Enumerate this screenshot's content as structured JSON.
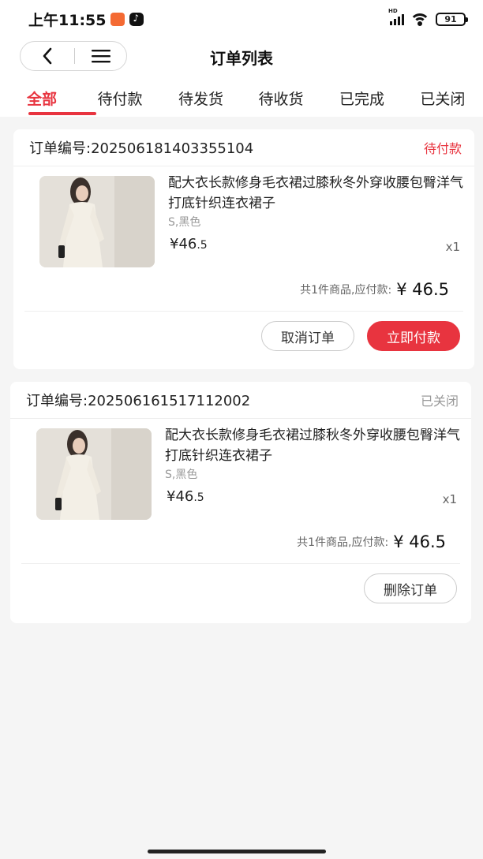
{
  "status_bar": {
    "time": "上午11:55",
    "battery": "91",
    "network": "HD"
  },
  "nav": {
    "title": "订单列表",
    "back_icon": "chevron-left-icon",
    "menu_icon": "hamburger-icon"
  },
  "tabs": [
    {
      "label": "全部"
    },
    {
      "label": "待付款"
    },
    {
      "label": "待发货"
    },
    {
      "label": "待收货"
    },
    {
      "label": "已完成"
    },
    {
      "label": "已关闭"
    }
  ],
  "active_tab": "全部",
  "orders": [
    {
      "order_no": "订单编号:2025061814033551​04",
      "status": "待付款",
      "item": {
        "title": "配大衣长款修身毛衣裙过膝秋冬外穿收腰包臀洋气打底针织连衣裙子",
        "spec": "S,黑色",
        "currency": "¥",
        "price_int": "46",
        "price_dec": ".5",
        "qty": "x1"
      },
      "summary_label": "共1件商品,应付款:",
      "summary_amount": "¥ 46.5",
      "buttons": [
        "取消订单",
        "立即付款"
      ]
    },
    {
      "order_no": "订单编号:202506161517112002",
      "status": "已关闭",
      "item": {
        "title": "配大衣长款修身毛衣裙过膝秋冬外穿收腰包臀洋气打底针织连衣裙子",
        "spec": "S,黑色",
        "currency": "¥",
        "price_int": "46",
        "price_dec": ".5",
        "qty": "x1"
      },
      "summary_label": "共1件商品,应付款:",
      "summary_amount": "¥ 46.5",
      "buttons": [
        "删除订单"
      ]
    }
  ],
  "colors": {
    "accent": "#e8343f",
    "closed": "#999999",
    "background": "#f5f5f5"
  }
}
